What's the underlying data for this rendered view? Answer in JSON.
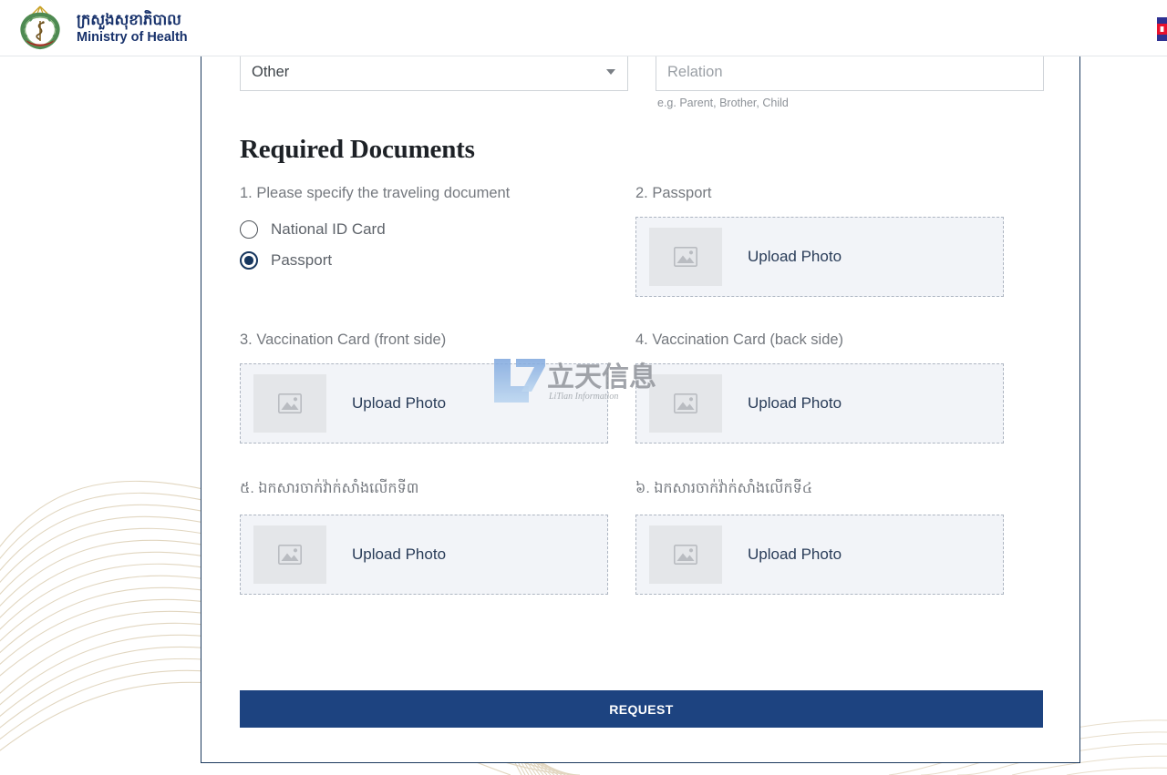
{
  "header": {
    "emblem_icon": "ministry-of-health-emblem-icon",
    "brand_khmer": "ក្រសួងសុខាភិបាល",
    "brand_english": "Ministry of Health",
    "flag_icon": "cambodia-flag-icon",
    "brand_color": "#17316b",
    "border_color": "#e3e6ea"
  },
  "form": {
    "relationship_select": {
      "selected_value": "Other",
      "options": [
        "Other"
      ],
      "caret_icon": "chevron-down-icon"
    },
    "relation_field": {
      "value": "",
      "placeholder": "Relation",
      "helper_text": "e.g. Parent, Brother, Child"
    }
  },
  "section": {
    "title": "Required Documents"
  },
  "documents": {
    "item1": {
      "label": "1. Please specify the traveling document",
      "options": [
        {
          "label": "National ID Card",
          "checked": false
        },
        {
          "label": "Passport",
          "checked": true
        }
      ]
    },
    "item2": {
      "label": "2. Passport",
      "upload_label": "Upload Photo",
      "thumb_icon": "image-placeholder-icon"
    },
    "item3": {
      "label": "3. Vaccination Card (front side)",
      "upload_label": "Upload Photo",
      "thumb_icon": "image-placeholder-icon"
    },
    "item4": {
      "label": "4. Vaccination Card (back side)",
      "upload_label": "Upload Photo",
      "thumb_icon": "image-placeholder-icon"
    },
    "item5": {
      "label": "៥. ឯកសារចាក់វ៉ាក់សាំងលើកទី៣",
      "upload_label": "Upload Photo",
      "thumb_icon": "image-placeholder-icon"
    },
    "item6": {
      "label": "៦. ឯកសារចាក់វ៉ាក់សាំងលើកទី៤",
      "upload_label": "Upload Photo",
      "thumb_icon": "image-placeholder-icon"
    }
  },
  "actions": {
    "request_label": "REQUEST",
    "request_color": "#1d4380"
  },
  "watermark": {
    "text_cn": "立天信息",
    "text_en": "LiTian Information"
  },
  "colors": {
    "card_border": "#1c3a5e",
    "upload_fill": "#f2f4f8",
    "upload_border": "#aeb6c2",
    "label_gray": "#75797f",
    "decor_gold": "#cbb894"
  }
}
